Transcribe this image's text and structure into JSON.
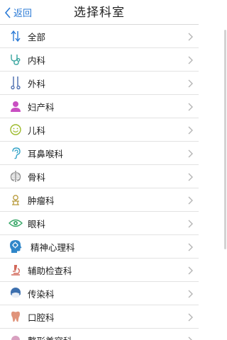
{
  "header": {
    "back_label": "返回",
    "title": "选择科室"
  },
  "departments": [
    {
      "label": "全部",
      "icon": "sort-arrows-icon"
    },
    {
      "label": "内科",
      "icon": "stethoscope-icon"
    },
    {
      "label": "外科",
      "icon": "surgical-tools-icon"
    },
    {
      "label": "妇产科",
      "icon": "woman-icon"
    },
    {
      "label": "儿科",
      "icon": "smiley-face-icon"
    },
    {
      "label": "耳鼻喉科",
      "icon": "ear-icon"
    },
    {
      "label": "骨科",
      "icon": "ribcage-icon"
    },
    {
      "label": "肿瘤科",
      "icon": "tumor-icon"
    },
    {
      "label": "眼科",
      "icon": "eye-icon"
    },
    {
      "label": "精神心理科",
      "icon": "brain-head-icon"
    },
    {
      "label": "辅助检查科",
      "icon": "microscope-icon"
    },
    {
      "label": "传染科",
      "icon": "mask-face-icon"
    },
    {
      "label": "口腔科",
      "icon": "tooth-icon"
    },
    {
      "label": "整形美容科",
      "icon": "partial-row-icon"
    }
  ],
  "colors": {
    "accent": "#2a7ad6",
    "divider": "#e2e2e2",
    "chevron": "#b5b5b5"
  }
}
